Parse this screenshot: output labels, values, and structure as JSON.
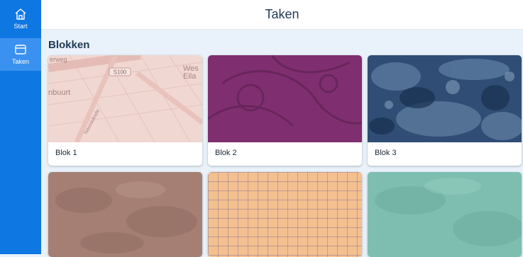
{
  "sidebar": {
    "items": [
      {
        "label": "Start",
        "icon": "home-icon"
      },
      {
        "label": "Taken",
        "icon": "window-icon"
      }
    ],
    "colors": {
      "background": "#0f77e2",
      "active": "#3b91ef"
    }
  },
  "header": {
    "title": "Taken"
  },
  "section": {
    "title": "Blokken",
    "cards": [
      {
        "label": "Blok 1"
      },
      {
        "label": "Blok 2"
      },
      {
        "label": "Blok 3"
      },
      {
        "label": ""
      },
      {
        "label": ""
      },
      {
        "label": ""
      }
    ]
  },
  "map_labels": {
    "street1": "erweg",
    "route": "S100",
    "place1": "Wes",
    "place2": "Eila",
    "district": "nbuurt",
    "street2": "Nassaukade"
  }
}
